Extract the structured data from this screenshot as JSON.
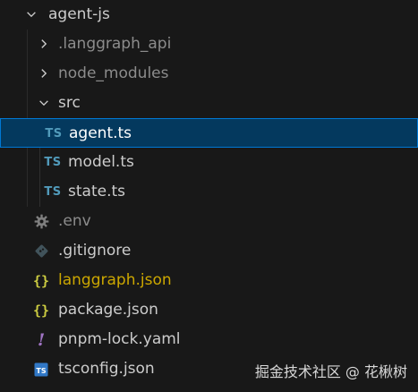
{
  "tree": {
    "root": {
      "label": "agent-js",
      "expanded": true
    },
    "items": [
      {
        "label": ".langgraph_api",
        "type": "folder",
        "expanded": false,
        "color": "#8c8c8c"
      },
      {
        "label": "node_modules",
        "type": "folder",
        "expanded": false,
        "color": "#8c8c8c"
      },
      {
        "label": "src",
        "type": "folder",
        "expanded": true,
        "color": "#cccccc"
      },
      {
        "label": "agent.ts",
        "type": "file",
        "icon": "TS",
        "selected": true,
        "color": "#ffffff"
      },
      {
        "label": "model.ts",
        "type": "file",
        "icon": "TS",
        "color": "#cccccc"
      },
      {
        "label": "state.ts",
        "type": "file",
        "icon": "TS",
        "color": "#cccccc"
      },
      {
        "label": ".env",
        "type": "file",
        "icon": "gear-icon",
        "color": "#8c8c8c"
      },
      {
        "label": ".gitignore",
        "type": "file",
        "icon": "git-icon",
        "color": "#cccccc"
      },
      {
        "label": "langgraph.json",
        "type": "file",
        "icon": "{ }",
        "color": "#cca700"
      },
      {
        "label": "package.json",
        "type": "file",
        "icon": "{ }",
        "color": "#cccccc"
      },
      {
        "label": "pnpm-lock.yaml",
        "type": "file",
        "icon": "!",
        "color": "#cccccc"
      },
      {
        "label": "tsconfig.json",
        "type": "file",
        "icon": "TS",
        "color": "#cccccc"
      }
    ]
  },
  "watermark": "掘金技术社区 @ 花楸树",
  "colors": {
    "background": "#181818",
    "selection": "#04395e",
    "selection_border": "#0078d4",
    "ts_icon": "#519aba",
    "json_icon": "#cbcb41",
    "yaml_icon": "#a074c4"
  }
}
